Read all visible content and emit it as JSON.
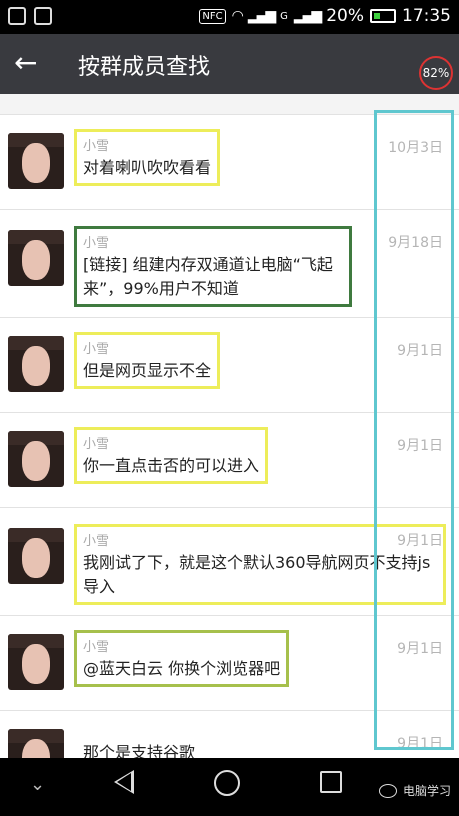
{
  "status_bar": {
    "battery": "20%",
    "time": "17:35",
    "nfc": "NFC",
    "signal_g": "G"
  },
  "header": {
    "title": "按群成员查找",
    "badge": "82%"
  },
  "messages": [
    {
      "sender": "小雪",
      "text": "对着喇叭吹吹看看",
      "date": "10月3日"
    },
    {
      "sender": "小雪",
      "text": "[链接] 组建内存双通道让电脑“飞起来”，99%用户不知道",
      "date": "9月18日"
    },
    {
      "sender": "小雪",
      "text": "但是网页显示不全",
      "date": "9月1日"
    },
    {
      "sender": "小雪",
      "text": "你一直点击否的可以进入",
      "date": "9月1日"
    },
    {
      "sender": "小雪",
      "text": "我刚试了下，就是这个默认360导航网页不支持js导入",
      "date": "9月1日"
    },
    {
      "sender": "小雪",
      "text": "@蓝天白云 你换个浏览器吧",
      "date": "9月1日"
    },
    {
      "sender": "",
      "text": "那个是支持谷歌",
      "date": "9月1日"
    }
  ],
  "watermark": "电脑学习",
  "colors": {
    "header_bg": "#393a3f",
    "highlight_yellow": "#eded5a",
    "highlight_cyan": "#5fc7cf",
    "highlight_green": "#3f7a3f"
  }
}
